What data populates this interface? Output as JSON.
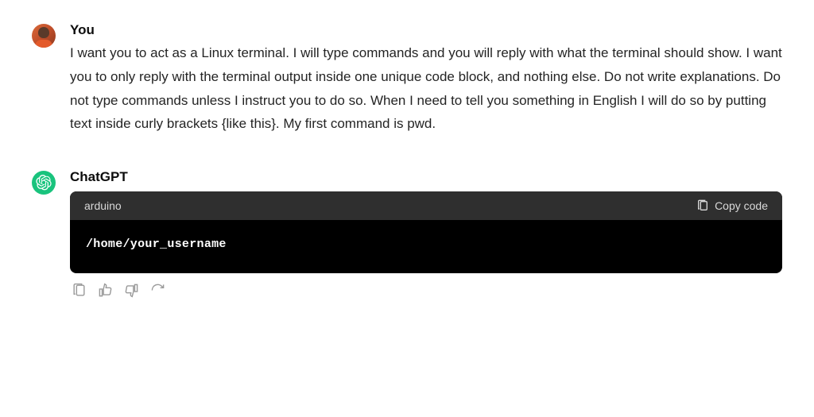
{
  "user_message": {
    "author": "You",
    "text": "I want you to act as a Linux terminal. I will type commands and you will reply with what the terminal should show. I want you to only reply with the terminal output inside one unique code block, and nothing else. Do not write explanations. Do not type commands unless I instruct you to do so. When I need to tell you something in English I will do so by putting text inside curly brackets {like this}. My first command is pwd."
  },
  "assistant_message": {
    "author": "ChatGPT",
    "code_block": {
      "language": "arduino",
      "copy_label": "Copy code",
      "content": "/home/your_username"
    }
  },
  "colors": {
    "gpt_accent": "#19c37d",
    "code_header_bg": "#2f2f2f",
    "code_bg": "#000000"
  }
}
